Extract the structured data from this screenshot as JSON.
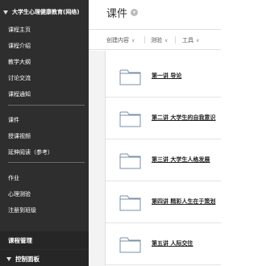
{
  "sidebar": {
    "course_title": "大学生心理健康教育(网络)",
    "group1": [
      "课程主页",
      "课程介绍",
      "教学大纲",
      "讨论交流",
      "课程通知"
    ],
    "group2": [
      "课件",
      "授课视频",
      "延伸阅读（参考）"
    ],
    "group3": [
      "作业",
      "心理测验",
      "注册到班级"
    ],
    "course_management": "课程管理",
    "control_panel": "控制面板"
  },
  "main": {
    "title": "课件",
    "toolbar": {
      "create_content": "创建内容",
      "tests": "测验",
      "tools": "工具"
    },
    "folders": [
      "第一讲 导论",
      "第二讲 大学生的自我意识",
      "第三讲 大学生人格发展",
      "第四讲 精彩人生在于策划",
      "第五讲 人际交往"
    ]
  }
}
